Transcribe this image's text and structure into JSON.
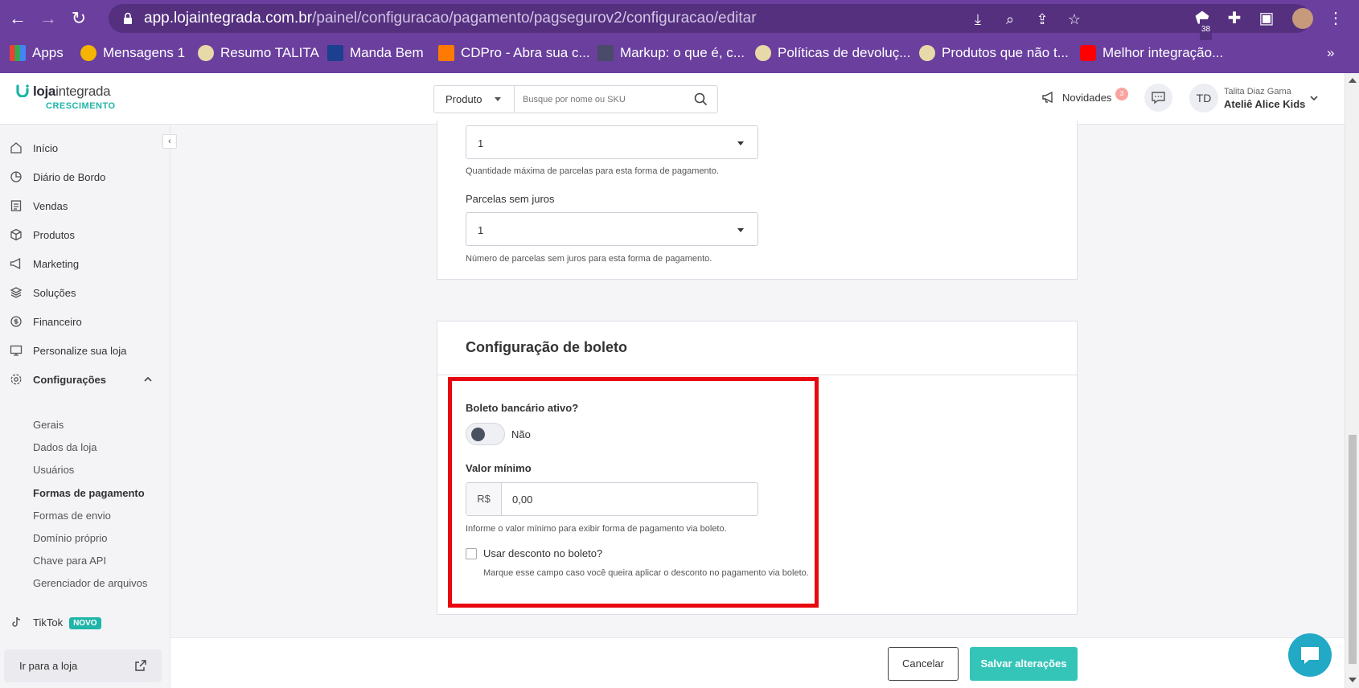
{
  "browser": {
    "url_host": "app.lojaintegrada.com.br",
    "url_path": "/painel/configuracao/pagamento/pagsegurov2/configuracao/editar",
    "extension_badge": "38",
    "bookmarks": [
      {
        "label": "Apps",
        "color": "#e94235"
      },
      {
        "label": "Mensagens 1",
        "color": "#f4b400"
      },
      {
        "label": "Resumo TALITA",
        "color": "#e8d9a8"
      },
      {
        "label": "Manda Bem",
        "color": "#1d3f8f"
      },
      {
        "label": "CDPro - Abra sua c...",
        "color": "#ff7a00"
      },
      {
        "label": "Markup: o que é, c...",
        "color": "#4a4a6a"
      },
      {
        "label": "Políticas de devoluç...",
        "color": "#e8d9a8"
      },
      {
        "label": "Produtos que não t...",
        "color": "#e8d9a8"
      },
      {
        "label": "Melhor integração...",
        "color": "#ff0000"
      }
    ],
    "more": "»"
  },
  "header": {
    "logo_main_bold": "loja",
    "logo_main_light": "integrada",
    "logo_sub": "CRESCIMENTO",
    "search_select": "Produto",
    "search_placeholder": "Busque por nome ou SKU",
    "novidades_label": "Novidades",
    "novidades_badge": "3",
    "avatar_initials": "TD",
    "user_name": "Talita Diaz Gama",
    "store_name": "Ateliê Alice Kids"
  },
  "sidebar": {
    "collapse": "‹",
    "items": [
      {
        "label": "Início"
      },
      {
        "label": "Diário de Bordo"
      },
      {
        "label": "Vendas"
      },
      {
        "label": "Produtos"
      },
      {
        "label": "Marketing"
      },
      {
        "label": "Soluções"
      },
      {
        "label": "Financeiro"
      },
      {
        "label": "Personalize sua loja"
      },
      {
        "label": "Configurações"
      }
    ],
    "sub_items": [
      {
        "label": "Gerais"
      },
      {
        "label": "Dados da loja"
      },
      {
        "label": "Usuários"
      },
      {
        "label": "Formas de pagamento"
      },
      {
        "label": "Formas de envio"
      },
      {
        "label": "Domínio próprio"
      },
      {
        "label": "Chave para API"
      },
      {
        "label": "Gerenciador de arquivos"
      }
    ],
    "tiktok_label": "TikTok",
    "tiktok_badge": "NOVO",
    "goto_store": "Ir para a loja"
  },
  "card1": {
    "max_installments_value": "1",
    "max_installments_help": "Quantidade máxima de parcelas para esta forma de pagamento.",
    "interest_free_label": "Parcelas sem juros",
    "interest_free_value": "1",
    "interest_free_help": "Número de parcelas sem juros para esta forma de pagamento."
  },
  "card2": {
    "title": "Configuração de boleto",
    "active_label": "Boleto bancário ativo?",
    "toggle_text": "Não",
    "min_value_label": "Valor mínimo",
    "currency_prefix": "R$",
    "min_value": "0,00",
    "min_value_help": "Informe o valor mínimo para exibir forma de pagamento via boleto.",
    "discount_label": "Usar desconto no boleto?",
    "discount_help": "Marque esse campo caso você queira aplicar o desconto no pagamento via boleto."
  },
  "footer": {
    "cancel_label": "Cancelar",
    "save_label": "Salvar alterações"
  },
  "colors": {
    "browser_chrome": "#6a3f9e",
    "accent": "#35c5b8",
    "highlight": "#e8070f",
    "chat_fab": "#21a9c5"
  }
}
